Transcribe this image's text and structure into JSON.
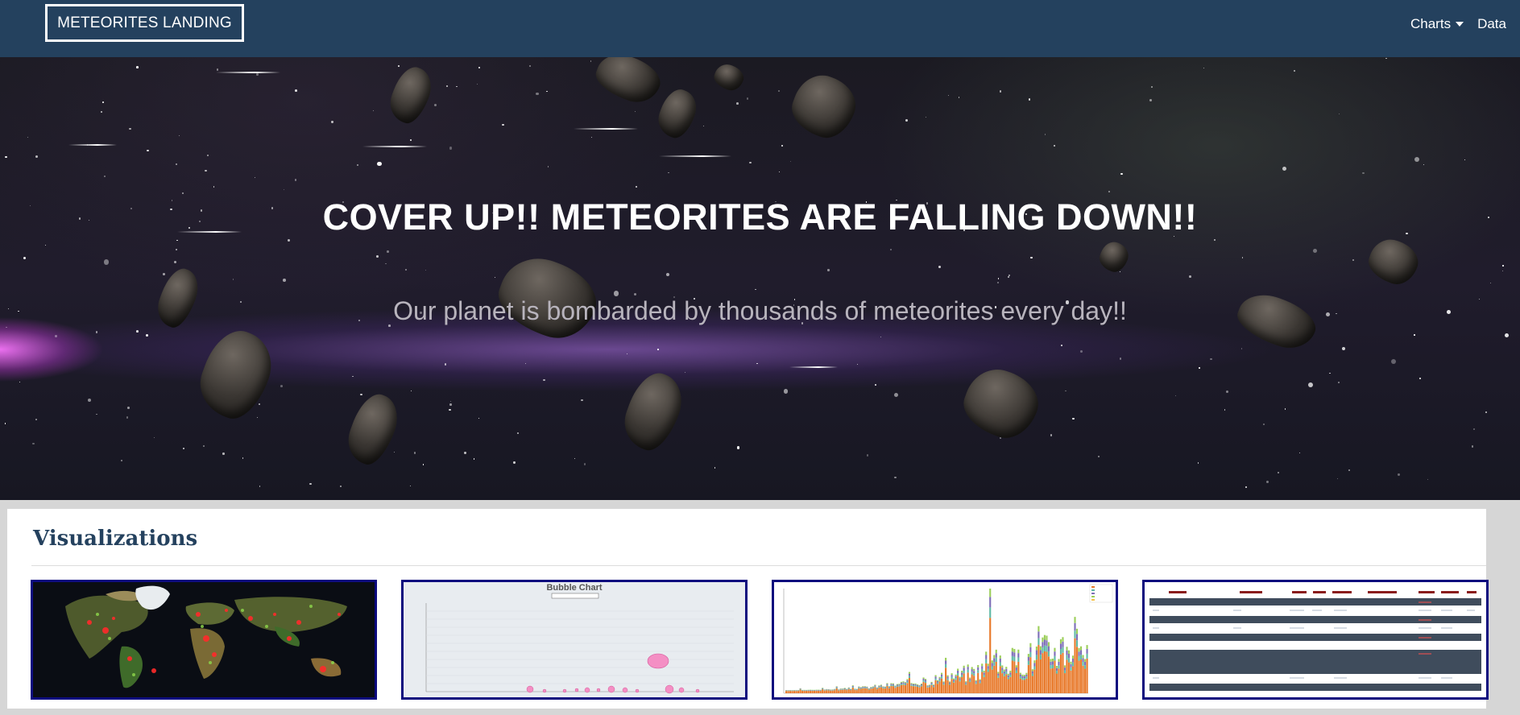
{
  "navbar": {
    "brand": "METEORITES LANDING",
    "links": [
      {
        "label": "Charts",
        "has_dropdown": true
      },
      {
        "label": "Data",
        "has_dropdown": false
      }
    ],
    "bg_color": "#24415e"
  },
  "hero": {
    "title": "COVER UP!! METEORITES ARE FALLING DOWN!!",
    "subtitle": "Our planet is bombarded by thousands of meteorites every day!!"
  },
  "visualizations": {
    "title": "Visualizations",
    "thumbnails": [
      {
        "name": "world-map-thumbnail"
      },
      {
        "name": "bubble-chart-thumbnail",
        "caption": "Bubble Chart"
      },
      {
        "name": "stacked-bar-chart-thumbnail"
      },
      {
        "name": "data-table-thumbnail"
      }
    ],
    "border_color": "#0c0a7e"
  }
}
